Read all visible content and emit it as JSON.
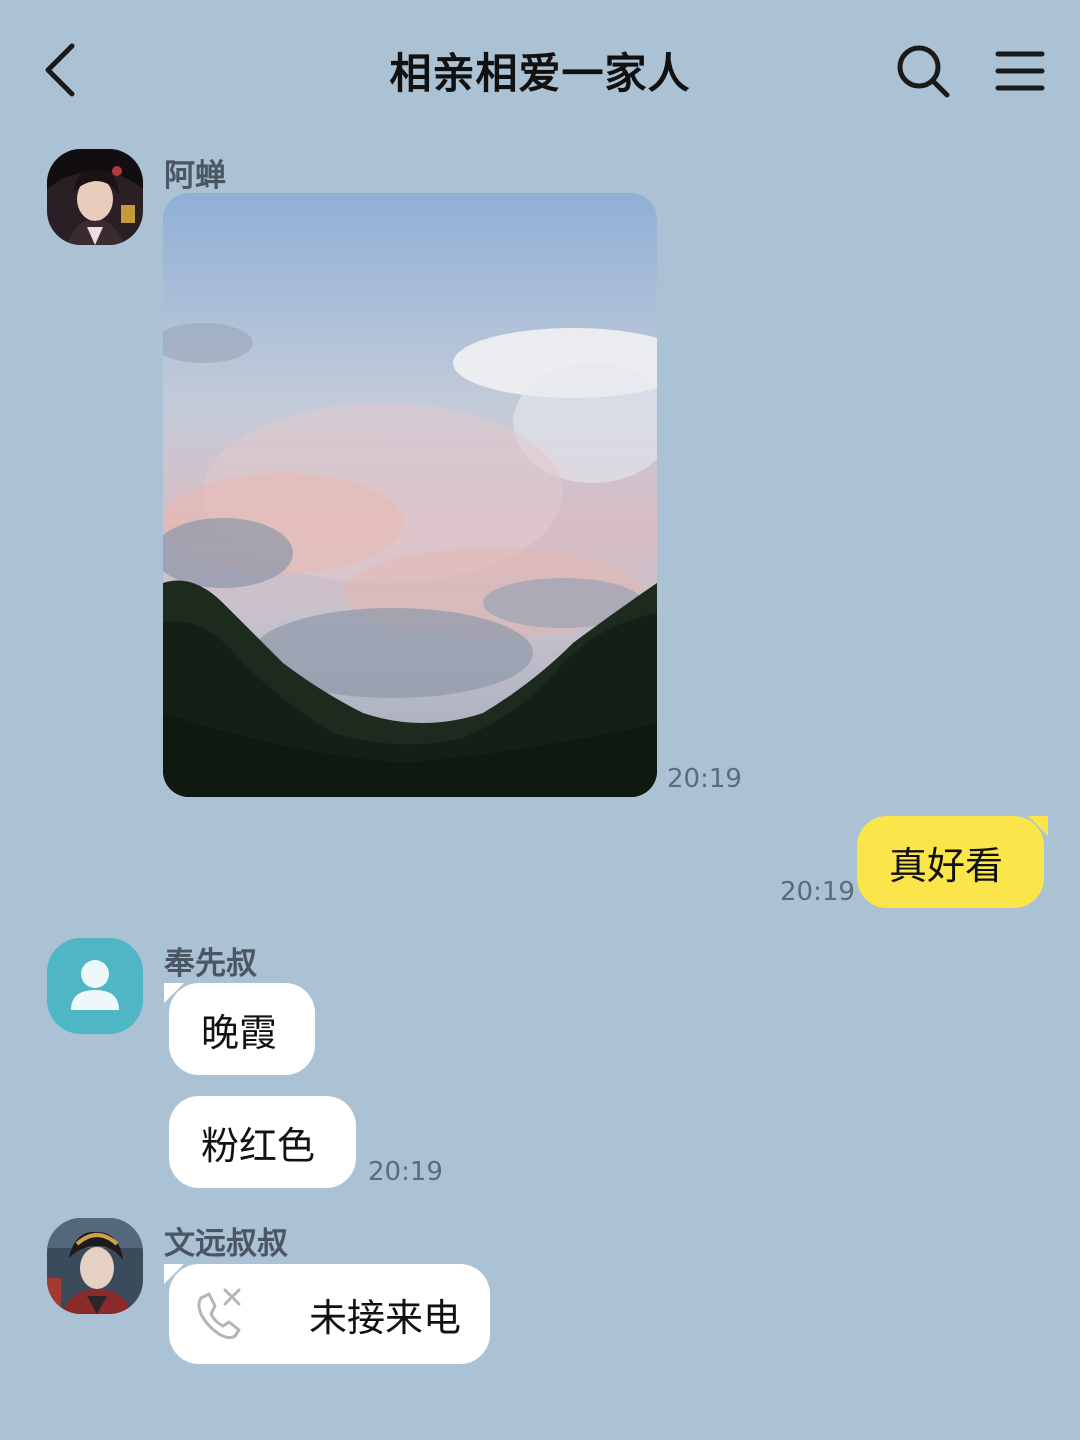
{
  "header": {
    "title": "相亲相爱一家人",
    "back_icon": "chevron-left-icon",
    "search_icon": "search-icon",
    "menu_icon": "menu-icon"
  },
  "messages": [
    {
      "sender": "阿蝉",
      "type": "image",
      "image": "sunset-sky-photo",
      "time": "20:19"
    },
    {
      "sender": "me",
      "type": "text",
      "text": "真好看",
      "time": "20:19"
    },
    {
      "sender": "奉先叔",
      "type": "text",
      "text": "晚霞"
    },
    {
      "sender": "奉先叔",
      "type": "text",
      "text": "粉红色",
      "time": "20:19"
    },
    {
      "sender": "文远叔叔",
      "type": "call",
      "text": "未接来电",
      "icon": "missed-call-icon"
    }
  ],
  "colors": {
    "background": "#abc1d4",
    "my_bubble": "#fae54a",
    "their_bubble": "#ffffff",
    "default_avatar": "#4fb6c6"
  }
}
